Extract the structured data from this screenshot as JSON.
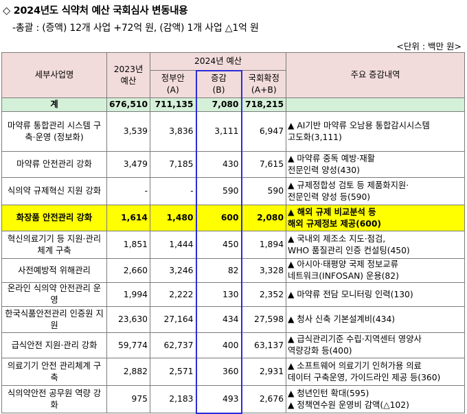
{
  "title": "◇ 2024년도 식약처 예산 국회심사 변동내용",
  "summary": "-총괄 : (증액) 12개 사업 +72억 원, (감액) 1개 사업 △1억 원",
  "unit": "<단위 : 백만 원>",
  "headers": {
    "name": "세부사업명",
    "y2023": "2023년 예산",
    "y2024": "2024년 예산",
    "gov": "정부안",
    "gov_sub": "(A)",
    "chg": "증감",
    "chg_sub": "(B)",
    "fin": "국회확정",
    "fin_sub": "(A+B)",
    "desc": "주요 증감내역"
  },
  "total": {
    "name": "계",
    "y2023": "676,510",
    "gov": "711,135",
    "chg": "7,080",
    "fin": "718,215"
  },
  "rows": [
    {
      "name": "마약류 통합관리 시스템 구축·운영 (정보화)",
      "y2023": "3,539",
      "gov": "3,836",
      "chg": "3,111",
      "fin": "6,947",
      "desc": [
        "▲ AI기반 마약류 오남용 통합감시시스템",
        "고도화(3,111)"
      ]
    },
    {
      "name": "마약류 안전관리 강화",
      "y2023": "3,479",
      "gov": "7,185",
      "chg": "430",
      "fin": "7,615",
      "desc": [
        "▲ 마약류 중독 예방·재활",
        "전문인력 양성(430)"
      ]
    },
    {
      "name": "식의약 규제혁신 지원 강화",
      "y2023": "-",
      "gov": "-",
      "chg": "590",
      "fin": "590",
      "desc": [
        "▲ 규제정합성 검토 등 제품화지원·",
        "전문인력 양성 등(590)"
      ]
    },
    {
      "name": "화장품 안전관리 강화",
      "y2023": "1,614",
      "gov": "1,480",
      "chg": "600",
      "fin": "2,080",
      "desc": [
        "▲ 해외 규제 비교분석 등",
        "해외 규제정보 제공(600)"
      ]
    },
    {
      "name": "혁신의료기기 등 지원·관리체계 구축",
      "y2023": "1,851",
      "gov": "1,444",
      "chg": "450",
      "fin": "1,894",
      "desc": [
        "▲ 국내외 제조소 지도·점검,",
        "WHO 품질관리 인증 컨설팅(450)"
      ]
    },
    {
      "name": "사전예방적 위해관리",
      "y2023": "2,660",
      "gov": "3,246",
      "chg": "82",
      "fin": "3,328",
      "desc": [
        "▲ 아시아·태평양 국제 정보교류",
        "네트워크(INFOSAN) 운용(82)"
      ]
    },
    {
      "name": "온라인 식의약 안전관리 운영",
      "y2023": "1,994",
      "gov": "2,222",
      "chg": "130",
      "fin": "2,352",
      "desc": [
        "▲ 마약류 전담 모니터링 인력(130)"
      ]
    },
    {
      "name": "한국식품안전관리 인증원 지원",
      "y2023": "23,630",
      "gov": "27,164",
      "chg": "434",
      "fin": "27,598",
      "desc": [
        "▲ 청사 신축 기본설계비(434)"
      ]
    },
    {
      "name": "급식안전 지원·관리 강화",
      "y2023": "59,774",
      "gov": "62,737",
      "chg": "400",
      "fin": "63,137",
      "desc": [
        "▲ 급식관리기준 수립·지역센터 영양사",
        "역량강화 등(400)"
      ]
    },
    {
      "name": "의료기기 안전 관리체계 구축",
      "y2023": "2,882",
      "gov": "2,571",
      "chg": "360",
      "fin": "2,931",
      "desc": [
        "▲ 소프트웨어 의료기기 인허가용 의료",
        "데이터 구축운영, 가이드라인 제공 등(360)"
      ]
    },
    {
      "name": "식의약안전 공무원 역량 강화",
      "y2023": "975",
      "gov": "2,183",
      "chg": "493",
      "fin": "2,676",
      "desc": [
        "▲ 청년인턴 확대(595)",
        "▲ 정책연수원 운영비 감액(△102)"
      ]
    }
  ]
}
